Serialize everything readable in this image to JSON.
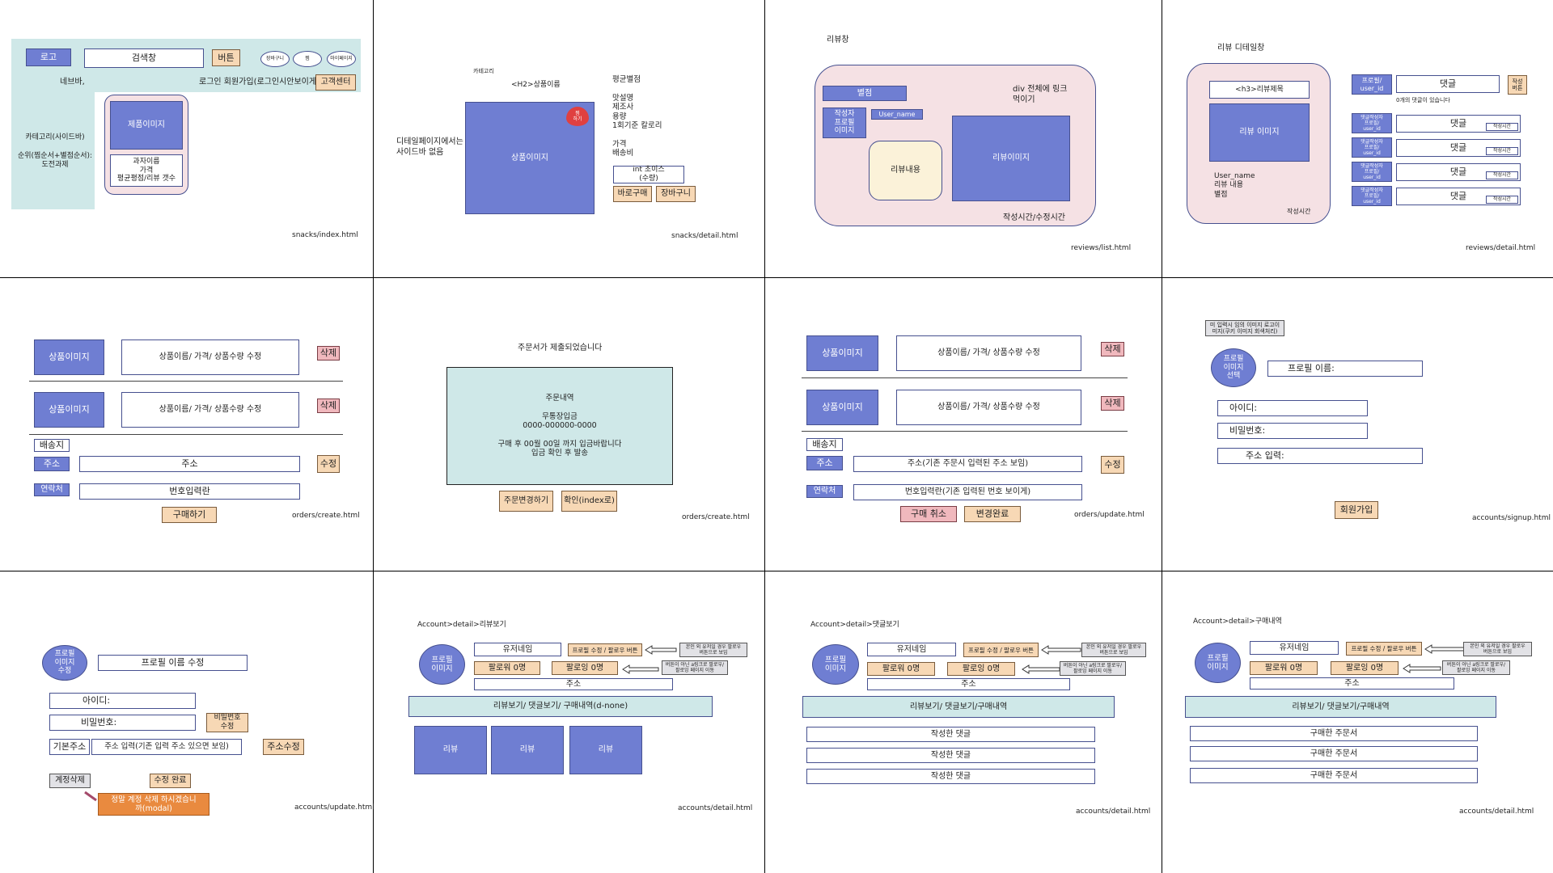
{
  "p1": {
    "logo": "로고",
    "search": "검색창",
    "button": "버튼",
    "cart": "장바구니",
    "heart": "찜",
    "mypage": "마이페이지",
    "navbar": "네브바,",
    "login": "로그인  회원가입(로그인시안보이게)",
    "cs": "고객센터",
    "sidebar": "카테고리(사이드바)\n\n순위(찜순서+별점순서):\n도전과제",
    "product_image": "제품이미지",
    "product_info": "과자이름\n가격\n평균평점/리뷰 갯수",
    "file": "snacks/index.html"
  },
  "p2": {
    "category": "카테고리",
    "title": "<H2>상품이름",
    "no_sidebar": "디테일페이지에서는\n사이드바 없음",
    "product_image": "상품이미지",
    "heart": "찜\n하기",
    "info": "평균별점\n\n맛설명\n제조사\n용량\n1회기준 칼로리\n\n가격\n배송비",
    "qty": "int 초이스\n(수량)",
    "buy": "바로구매",
    "cart": "장바구니",
    "file": "snacks/detail.html"
  },
  "p3": {
    "title": "리뷰창",
    "rating": "별점",
    "writer": "작성자\n프로필\n이미지",
    "username": "User_name",
    "content": "리뷰내용",
    "link_note": "div 전체에 링크\n먹이기",
    "image": "리뷰이미지",
    "time": "작성시간/수정시간",
    "file": "reviews/list.html"
  },
  "p4": {
    "title": "리뷰 디테일창",
    "h3": "<h3>리뷰제목",
    "image": "리뷰 이미지",
    "info": "User_name\n리뷰 내용\n별점",
    "time": "작성시간",
    "profile": "프로필/\nuser_id",
    "comment": "댓글",
    "write": "작성\n버튼",
    "count": "0개의 댓글이 있습니다",
    "commenter": "댓글작성자\n프로필/\nuser_id",
    "ctime": "작성시간",
    "file": "reviews/detail.html"
  },
  "p5": {
    "product_image": "상품이미지",
    "product_info": "상품이름/ 가격/ 상품수량 수정",
    "delete": "삭제",
    "shipping": "배송지",
    "address_label": "주소",
    "address": "주소",
    "edit": "수정",
    "contact_label": "연락처",
    "phone": "번호입력란",
    "order": "구매하기",
    "file": "orders/create.html"
  },
  "p6": {
    "title": "주문서가 제출되었습니다",
    "content": "주문내역\n\n무통장입금\n0000-000000-0000\n\n구매 후 00월 00일 까지 입금바랍니다\n입금 확인 후 발송",
    "change": "주문변경하기",
    "ok": "확인(index로)",
    "file": "orders/create.html"
  },
  "p7": {
    "product_image": "상품이미지",
    "product_info": "상품이름/ 가격/ 상품수량 수정",
    "delete": "삭제",
    "shipping": "배송지",
    "address_label": "주소",
    "address": "주소(기존 주문시 입력된 주소 보임)",
    "edit": "수정",
    "contact_label": "연락처",
    "phone": "번호입력란(기존 입력된 번호 보이게)",
    "cancel": "구매 취소",
    "done": "변경완료",
    "file": "orders/update.html"
  },
  "p8": {
    "note": "미 입력시 임의 이미지 로고이\n미지(쿠키 이미지 회색처리)",
    "profile": "프로필\n이미지\n선택",
    "name": "프로필 이름:",
    "id": "아이디:",
    "pw": "비밀번호:",
    "address": "주소 입력:",
    "signup": "회원가입",
    "file": "accounts/signup.html"
  },
  "p9": {
    "profile": "프로필\n이미지\n수정",
    "name": "프로필 이름 수정",
    "id": "아이디:",
    "pw": "비밀번호:",
    "pw_edit": "비밀번호\n수정",
    "base_addr": "기본주소",
    "address": "주소 입력(기존 입력 주소 있으면 보임)",
    "addr_edit": "주소수정",
    "delete": "계정삭제",
    "done": "수정 완료",
    "modal": "정말 계정 삭제 하시겠습니\n까(modal)",
    "file": "accounts/update.html"
  },
  "p10": {
    "crumb": "Account>detail>리뷰보기",
    "profile": "프로필\n이미지",
    "username": "유저네임",
    "follow_btn": "프로필 수정 / 팔로우 버튼",
    "note1": "본인 외 유저일 경우 팔로우\n버튼으로 보임",
    "followers": "팔로워 0명",
    "following": "팔로잉 0명",
    "note2": "버튼이 아닌 a링크로 팔로우/\n팔로잉 페이지 이동",
    "address": "주소",
    "tabs": "리뷰보기/ 댓글보기/ 구매내역(d-none)",
    "review": "리뷰",
    "file": "accounts/detail.html"
  },
  "p11": {
    "crumb": "Account>detail>댓글보기",
    "profile": "프로필\n이미지",
    "username": "유저네임",
    "follow_btn": "프로필 수정 / 팔로우 버튼",
    "note1": "본인 외 유저일 경우 팔로우\n버튼으로 보임",
    "followers": "팔로워 0명",
    "following": "팔로잉 0명",
    "note2": "버튼이 아닌 a링크로 팔로우/\n팔로잉 페이지 이동",
    "address": "주소",
    "tabs": "리뷰보기/ 댓글보기/구매내역",
    "item": "작성한 댓글",
    "file": "accounts/detail.html"
  },
  "p12": {
    "crumb": "Account>detail>구매내역",
    "profile": "프로필\n이미지",
    "username": "유저네임",
    "follow_btn": "프로필 수정 / 팔로우 버튼",
    "note1": "본인 외 유저일 경우 팔로우\n버튼으로 보임",
    "followers": "팔로워 0명",
    "following": "팔로잉 0명",
    "note2": "버튼이 아닌 a링크로 팔로우/\n팔로잉 페이지 이동",
    "address": "주소",
    "tabs": "리뷰보기/ 댓글보기/구매내역",
    "item": "구매한 주문서",
    "file": "accounts/detail.html"
  }
}
